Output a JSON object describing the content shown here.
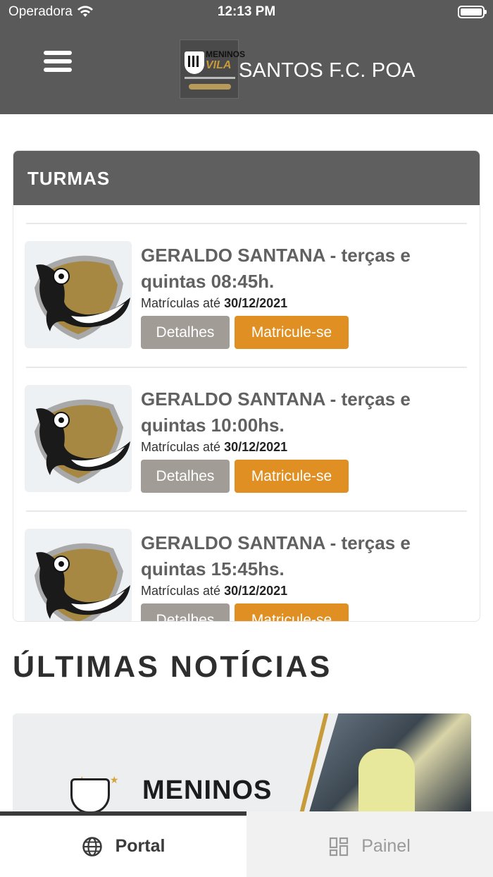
{
  "status_bar": {
    "carrier": "Operadora",
    "time": "12:13 PM"
  },
  "header": {
    "brand_name": "SANTOS F.C. POA",
    "logo_text_top": "MENINOS",
    "logo_text_vila": "VILA"
  },
  "turmas": {
    "title": "TURMAS",
    "items": [
      {
        "title": "GERALDO SANTANA - terças e quintas 08:45h.",
        "enroll_label": "Matrículas até",
        "enroll_date": "30/12/2021",
        "details_label": "Detalhes",
        "enroll_button": "Matricule-se"
      },
      {
        "title": "GERALDO SANTANA - terças e quintas 10:00hs.",
        "enroll_label": "Matrículas até",
        "enroll_date": "30/12/2021",
        "details_label": "Detalhes",
        "enroll_button": "Matricule-se"
      },
      {
        "title": "GERALDO SANTANA - terças e quintas 15:45hs.",
        "enroll_label": "Matrículas até",
        "enroll_date": "30/12/2021",
        "details_label": "Detalhes",
        "enroll_button": "Matricule-se"
      }
    ]
  },
  "news": {
    "title": "ÚLTIMAS NOTÍCIAS",
    "banner_text": "MENINOS"
  },
  "tab_bar": {
    "portal_label": "Portal",
    "painel_label": "Painel"
  },
  "icons": {
    "menu": "hamburger-icon",
    "portal": "globe-icon",
    "painel": "dashboard-icon",
    "wifi": "wifi-icon",
    "battery": "battery-icon"
  },
  "colors": {
    "header_bg": "#5a5a5a",
    "accent_orange": "#e08f22",
    "detalhes_gray": "#a19d96"
  }
}
